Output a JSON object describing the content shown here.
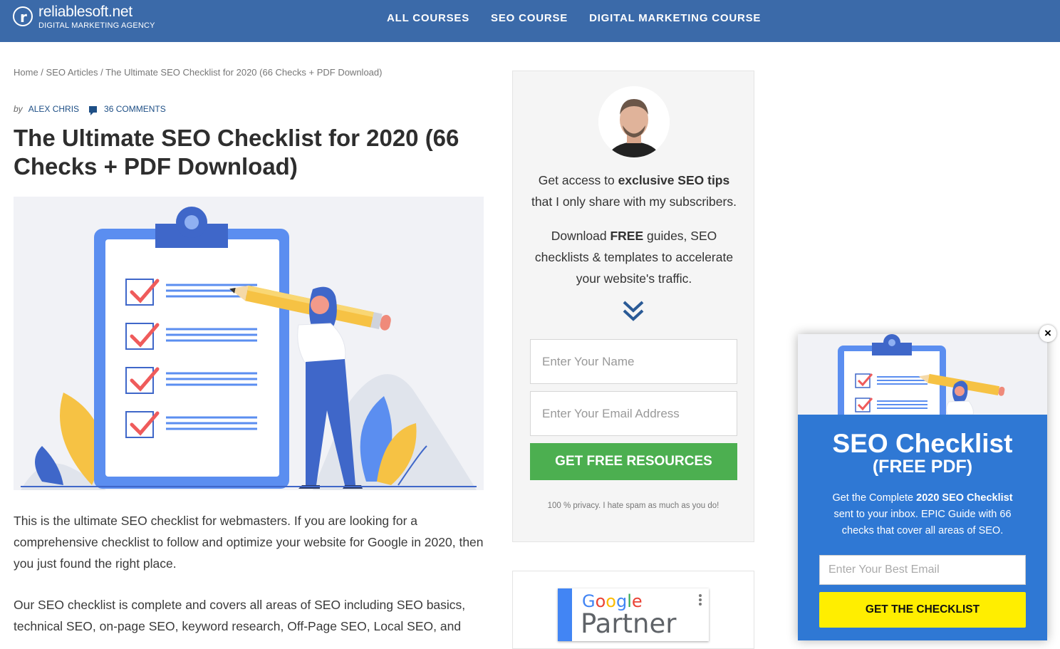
{
  "header": {
    "logo_letter": "r",
    "logo_name": "reliablesoft.net",
    "logo_tagline": "DIGITAL MARKETING AGENCY",
    "nav": [
      "ALL COURSES",
      "SEO COURSE",
      "DIGITAL MARKETING COURSE"
    ],
    "brand_color": "#3b6aa9"
  },
  "breadcrumb": {
    "items": [
      "Home",
      "SEO Articles",
      "The Ultimate SEO Checklist for 2020 (66 Checks + PDF Download)"
    ],
    "separator": " / "
  },
  "meta": {
    "by": "by",
    "author": "ALEX CHRIS",
    "comments": "36 COMMENTS",
    "comment_icon": "comment-icon"
  },
  "article": {
    "title": "The Ultimate SEO Checklist for 2020 (66 Checks + PDF Download)",
    "paragraphs": [
      "This is the ultimate SEO checklist for webmasters. If you are looking for a comprehensive checklist to follow and optimize your website for Google in 2020, then you just found the right place.",
      "Our SEO checklist is complete and covers all areas of SEO including SEO basics, technical SEO, on-page SEO, keyword research, Off-Page SEO, Local SEO, and"
    ]
  },
  "optin": {
    "line1_pre": "Get access to ",
    "line1_bold": "exclusive SEO tips",
    "line1_post": " that I only share with my subscribers.",
    "line2_pre": "Download ",
    "line2_bold": "FREE",
    "line2_post": " guides, SEO checklists & templates to accelerate your website's traffic.",
    "name_placeholder": "Enter Your Name",
    "email_placeholder": "Enter Your Email Address",
    "button": "GET FREE RESOURCES",
    "privacy": "100 % privacy. I hate spam as much as you do!",
    "button_color": "#4caf50"
  },
  "partner": {
    "google": "Google",
    "partner": "Partner"
  },
  "popup": {
    "close": "×",
    "title": "SEO Checklist",
    "subtitle": "(FREE PDF)",
    "desc_pre": "Get the Complete ",
    "desc_bold": "2020 SEO Checklist",
    "desc_post": " sent to your inbox. EPIC Guide with 66 checks that cover all areas of SEO.",
    "email_placeholder": "Enter Your Best Email",
    "button": "GET THE CHECKLIST",
    "bg_color": "#2f78d4",
    "button_color": "#ffee00"
  }
}
